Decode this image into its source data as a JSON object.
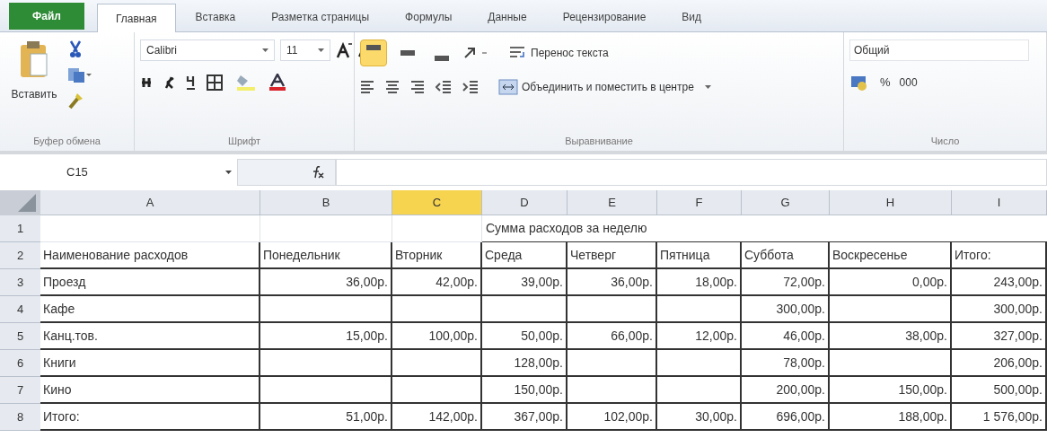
{
  "tabs": [
    {
      "label": "Файл",
      "kind": "file",
      "selected": false
    },
    {
      "label": "Главная",
      "kind": "tab",
      "selected": true
    },
    {
      "label": "Вставка",
      "kind": "tab",
      "selected": false
    },
    {
      "label": "Разметка страницы",
      "kind": "tab",
      "selected": false
    },
    {
      "label": "Формулы",
      "kind": "tab",
      "selected": false
    },
    {
      "label": "Данные",
      "kind": "tab",
      "selected": false
    },
    {
      "label": "Рецензирование",
      "kind": "tab",
      "selected": false
    },
    {
      "label": "Вид",
      "kind": "tab",
      "selected": false
    }
  ],
  "ribbon": {
    "clipboard": {
      "paste": "Вставить",
      "label": "Буфер обмена"
    },
    "font": {
      "name": "Calibri",
      "size": "11",
      "label": "Шрифт"
    },
    "alignment": {
      "vertical": [
        {
          "selected": true
        },
        {
          "selected": false
        },
        {
          "selected": false
        }
      ],
      "wrap": "Перенос текста",
      "merge": "Объединить и поместить в центре",
      "label": "Выравнивание"
    },
    "number": {
      "format": "Общий",
      "percent": "%",
      "thousands": "000",
      "label": "Число"
    }
  },
  "formula_bar": {
    "name_box": "C15"
  },
  "sheet": {
    "columns": [
      {
        "label": "A",
        "selected": false
      },
      {
        "label": "B",
        "selected": false
      },
      {
        "label": "C",
        "selected": true
      },
      {
        "label": "D",
        "selected": false
      },
      {
        "label": "E",
        "selected": false
      },
      {
        "label": "F",
        "selected": false
      },
      {
        "label": "G",
        "selected": false
      },
      {
        "label": "H",
        "selected": false
      },
      {
        "label": "I",
        "selected": false
      }
    ],
    "rows": [
      {
        "number": "1",
        "kind": "title",
        "title": "Сумма расходов за неделю"
      },
      {
        "number": "2",
        "kind": "header",
        "cells": [
          "Наименование расходов",
          "Понедельник",
          "Вторник",
          "Среда",
          "Четверг",
          "Пятница",
          "Суббота",
          "Воскресенье",
          "Итого:"
        ]
      },
      {
        "number": "3",
        "kind": "data",
        "cells": [
          "Проезд",
          "36,00р.",
          "42,00р.",
          "39,00р.",
          "36,00р.",
          "18,00р.",
          "72,00р.",
          "0,00р.",
          "243,00р."
        ]
      },
      {
        "number": "4",
        "kind": "data",
        "cells": [
          "Кафе",
          null,
          null,
          null,
          null,
          null,
          "300,00р.",
          null,
          "300,00р."
        ]
      },
      {
        "number": "5",
        "kind": "data",
        "cells": [
          "Канц.тов.",
          "15,00р.",
          "100,00р.",
          "50,00р.",
          "66,00р.",
          "12,00р.",
          "46,00р.",
          "38,00р.",
          "327,00р."
        ]
      },
      {
        "number": "6",
        "kind": "data",
        "cells": [
          "Книги",
          null,
          null,
          "128,00р.",
          null,
          null,
          "78,00р.",
          null,
          "206,00р."
        ]
      },
      {
        "number": "7",
        "kind": "data",
        "cells": [
          "Кино",
          null,
          null,
          "150,00р.",
          null,
          null,
          "200,00р.",
          "150,00р.",
          "500,00р."
        ]
      },
      {
        "number": "8",
        "kind": "data",
        "cells": [
          "Итого:",
          "51,00р.",
          "142,00р.",
          "367,00р.",
          "102,00р.",
          "30,00р.",
          "696,00р.",
          "188,00р.",
          "1 576,00р."
        ]
      }
    ]
  }
}
